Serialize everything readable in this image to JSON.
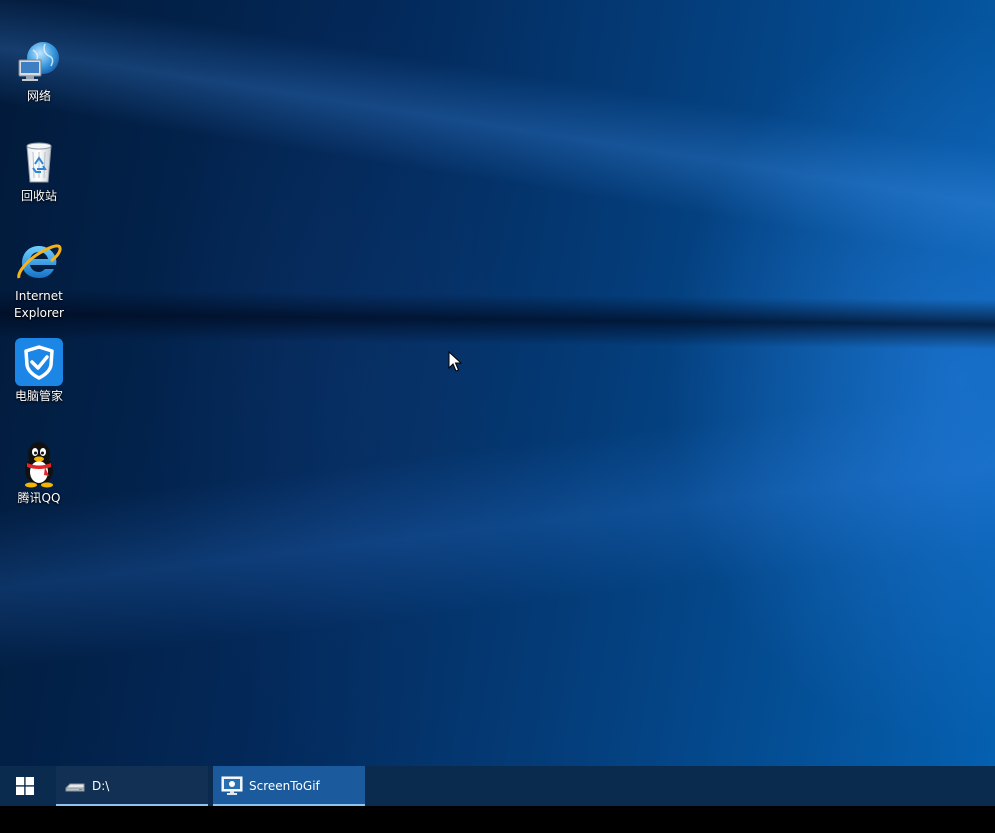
{
  "desktop": {
    "icons": [
      {
        "label": "网络"
      },
      {
        "label": "回收站"
      },
      {
        "label_line1": "Internet",
        "label_line2": "Explorer"
      },
      {
        "label": "电脑管家"
      },
      {
        "label": "腾讯QQ"
      }
    ]
  },
  "taskbar": {
    "start_icon": "windows-logo-icon",
    "buttons": [
      {
        "label": "D:\\",
        "icon": "drive-icon"
      },
      {
        "label": "ScreenToGif",
        "icon": "monitor-icon",
        "active": true
      }
    ]
  },
  "colors": {
    "taskbar": "#0a2a4e",
    "active_task": "#1b5a9c",
    "task_underline": "#8fc4f0"
  }
}
